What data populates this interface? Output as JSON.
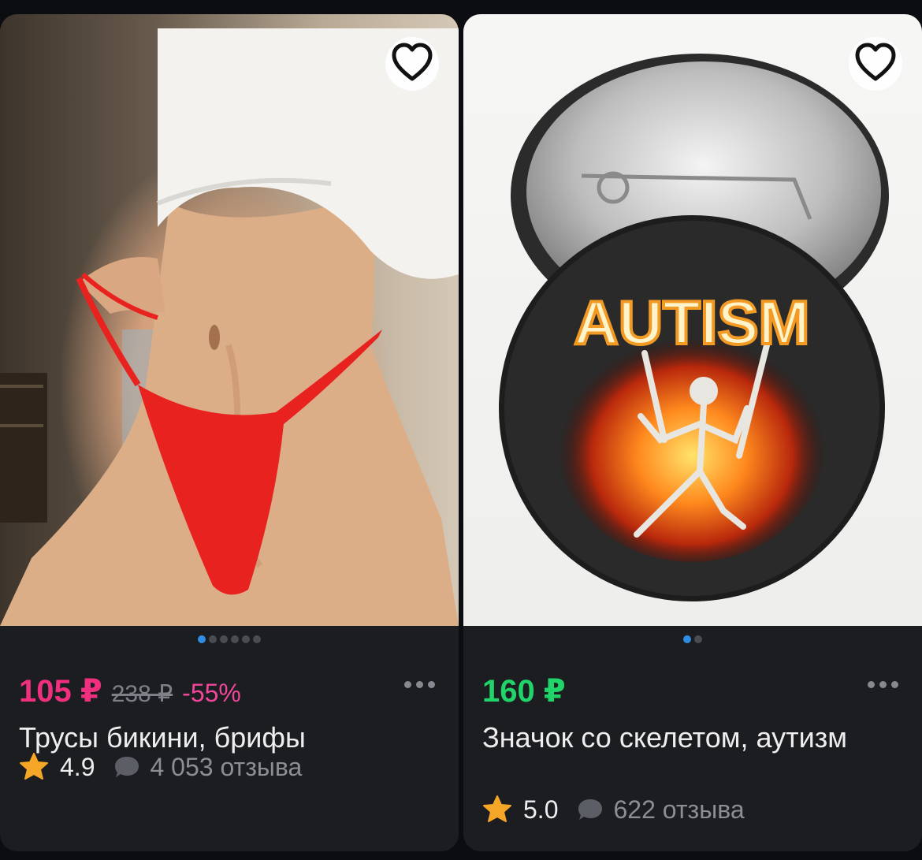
{
  "colors": {
    "price_sale": "#f0307f",
    "price_normal": "#21d46a",
    "discount": "#f1479a",
    "star": "#f6a626",
    "dot_active": "#2f8de4",
    "card_bg": "#1c1d21"
  },
  "products": [
    {
      "price": "105 ₽",
      "old_price": "238 ₽",
      "discount": "-55%",
      "title": "Трусы бикини, брифы",
      "rating": "4.9",
      "reviews": "4 053 отзыва",
      "image_count": 6,
      "active_image": 0,
      "favorite_icon": "heart-outline-icon"
    },
    {
      "price": "160 ₽",
      "title": "Значок со скелетом, аутизм",
      "rating": "5.0",
      "reviews": "622 отзыва",
      "image_count": 2,
      "active_image": 0,
      "favorite_icon": "heart-outline-icon",
      "badge_text": "AUTISM"
    }
  ]
}
